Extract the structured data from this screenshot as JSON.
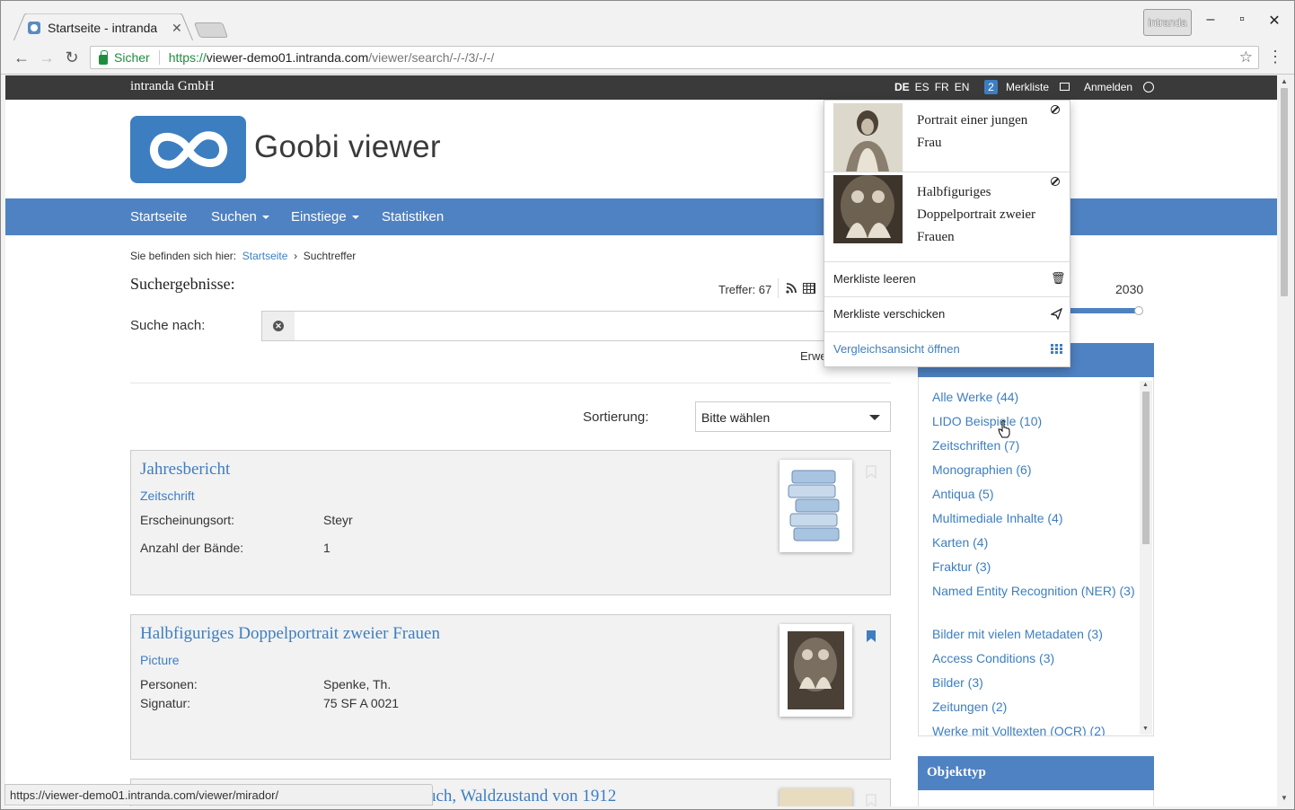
{
  "browser": {
    "tab_title": "Startseite - intranda",
    "profile": "intranda",
    "secure_label": "Sicher",
    "url_scheme": "https://",
    "url_host": "viewer-demo01.intranda.com",
    "url_path": "/viewer/search/-/-/3/-/-/",
    "status_url": "https://viewer-demo01.intranda.com/viewer/mirador/"
  },
  "topbar": {
    "brand": "intranda GmbH",
    "languages": [
      "DE",
      "ES",
      "FR",
      "EN"
    ],
    "active_language": "DE",
    "merkliste_count": "2",
    "merkliste_label": "Merkliste",
    "login_label": "Anmelden"
  },
  "logo": {
    "text": "Goobi viewer",
    "color": "#3d7ec1"
  },
  "nav": {
    "items": [
      "Startseite",
      "Suchen",
      "Einstiege",
      "Statistiken"
    ]
  },
  "breadcrumb": {
    "prefix": "Sie befinden sich hier:",
    "home": "Startseite",
    "separator": "›",
    "current": "Suchtreffer"
  },
  "results": {
    "heading": "Suchergebnisse:",
    "hits_label": "Treffer: 67",
    "search_label": "Suche nach:",
    "search_value": "",
    "advanced_label": "Erwe",
    "sort_label": "Sortierung:",
    "sort_value": "Bitte wählen"
  },
  "hits": [
    {
      "title": "Jahresbericht",
      "type": "Zeitschrift",
      "meta": [
        {
          "key": "Erscheinungsort:",
          "value": "Steyr"
        },
        {
          "key": "Anzahl der Bände:",
          "value": "1"
        }
      ],
      "bookmarked": false
    },
    {
      "title": "Halbfiguriges Doppelportrait zweier Frauen",
      "type": "Picture",
      "meta": [
        {
          "key": "Personen:",
          "value": "Spenke, Th."
        },
        {
          "key": "Signatur:",
          "value": "75 SF A 0021"
        }
      ],
      "bookmarked": true
    },
    {
      "title": "uch, Waldzustand von 1912"
    }
  ],
  "sidebar": {
    "year_max": "2030",
    "facets": [
      "Alle Werke (44)",
      "LIDO Beispiele (10)",
      "Zeitschriften (7)",
      "Monographien (6)",
      "Antiqua (5)",
      "Multimediale Inhalte (4)",
      "Karten (4)",
      "Fraktur (3)",
      "Named Entity Recognition (NER) (3)",
      "Bilder mit vielen Metadaten (3)",
      "Access Conditions (3)",
      "Bilder (3)",
      "Zeitungen (2)",
      "Werke mit Volltexten (OCR) (2)"
    ],
    "objekttyp_heading": "Objekttyp"
  },
  "merkliste_dropdown": {
    "items": [
      {
        "title": "Portrait einer jungen Frau"
      },
      {
        "title": "Halbfiguriges Doppelportrait zweier Frauen"
      }
    ],
    "actions": {
      "clear": "Merkliste leeren",
      "send": "Merkliste verschicken",
      "compare": "Vergleichsansicht öffnen"
    }
  },
  "colors": {
    "accent": "#4f82c2",
    "link": "#3d7ec1",
    "topbar": "#3a3a3a"
  }
}
